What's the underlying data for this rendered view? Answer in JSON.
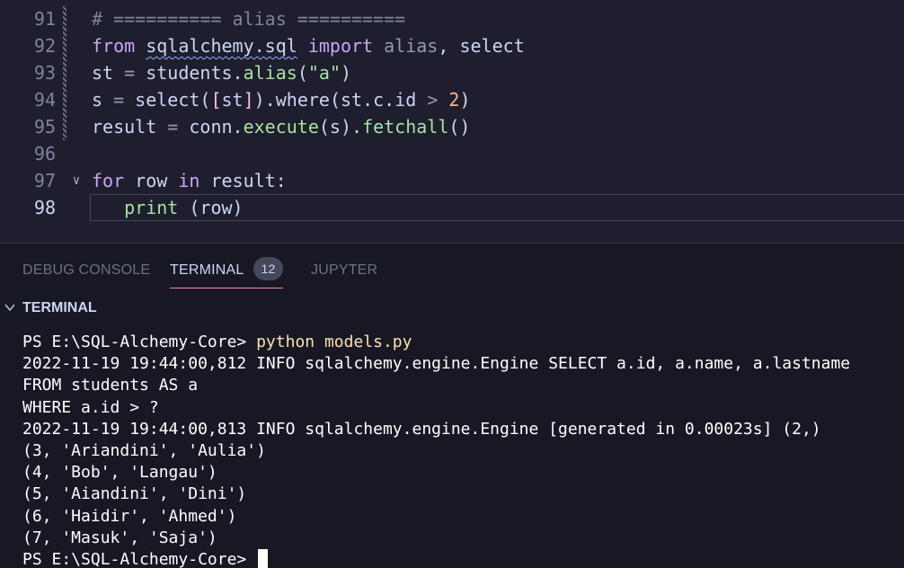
{
  "editor": {
    "lines": [
      {
        "num": "91",
        "tokens": [
          {
            "t": "# ========== alias ==========",
            "c": "c"
          }
        ]
      },
      {
        "num": "92",
        "tokens": [
          {
            "t": "from",
            "c": "k"
          },
          {
            "t": " ",
            "c": ""
          },
          {
            "t": "sqlalchemy.sql",
            "c": "sq"
          },
          {
            "t": " ",
            "c": ""
          },
          {
            "t": "import",
            "c": "k"
          },
          {
            "t": " ",
            "c": ""
          },
          {
            "t": "alias",
            "c": "p"
          },
          {
            "t": ", select",
            "c": ""
          }
        ]
      },
      {
        "num": "93",
        "tokens": [
          {
            "t": "st ",
            "c": ""
          },
          {
            "t": "=",
            "c": "p"
          },
          {
            "t": " students.",
            "c": ""
          },
          {
            "t": "alias",
            "c": "f"
          },
          {
            "t": "(",
            "c": ""
          },
          {
            "t": "\"a\"",
            "c": "s"
          },
          {
            "t": ")",
            "c": ""
          }
        ]
      },
      {
        "num": "94",
        "tokens": [
          {
            "t": "s ",
            "c": ""
          },
          {
            "t": "=",
            "c": "p"
          },
          {
            "t": " select(",
            "c": ""
          },
          {
            "t": "[",
            "c": "b"
          },
          {
            "t": "st",
            "c": ""
          },
          {
            "t": "]",
            "c": "b"
          },
          {
            "t": ").where(st.c.id ",
            "c": ""
          },
          {
            "t": ">",
            "c": "p"
          },
          {
            "t": " ",
            "c": ""
          },
          {
            "t": "2",
            "c": "n"
          },
          {
            "t": ")",
            "c": ""
          }
        ]
      },
      {
        "num": "95",
        "tokens": [
          {
            "t": "result ",
            "c": ""
          },
          {
            "t": "=",
            "c": "p"
          },
          {
            "t": " conn.",
            "c": ""
          },
          {
            "t": "execute",
            "c": "f"
          },
          {
            "t": "(s).",
            "c": ""
          },
          {
            "t": "fetchall",
            "c": "f"
          },
          {
            "t": "()",
            "c": ""
          }
        ]
      },
      {
        "num": "96",
        "tokens": []
      },
      {
        "num": "97",
        "fold": "∨",
        "tokens": [
          {
            "t": "for",
            "c": "k"
          },
          {
            "t": " row ",
            "c": ""
          },
          {
            "t": "in",
            "c": "k"
          },
          {
            "t": " result:",
            "c": ""
          }
        ]
      },
      {
        "num": "98",
        "current": true,
        "tokens": [
          {
            "t": "   ",
            "c": ""
          },
          {
            "t": "print",
            "c": "f"
          },
          {
            "t": " (row)",
            "c": ""
          }
        ]
      }
    ]
  },
  "panel": {
    "tabs": [
      {
        "label": "DEBUG CONSOLE",
        "active": false
      },
      {
        "label": "TERMINAL",
        "active": true,
        "badge": "12"
      },
      {
        "label": "JUPYTER",
        "active": false
      }
    ],
    "section_title": "TERMINAL",
    "terminal": {
      "prompt1": "PS E:\\SQL-Alchemy-Core> ",
      "command": "python models.py",
      "output": [
        "2022-11-19 19:44:00,812 INFO sqlalchemy.engine.Engine SELECT a.id, a.name, a.lastname",
        "FROM students AS a",
        "WHERE a.id > ?",
        "2022-11-19 19:44:00,813 INFO sqlalchemy.engine.Engine [generated in 0.00023s] (2,)",
        "(3, 'Ariandini', 'Aulia')",
        "(4, 'Bob', 'Langau')",
        "(5, 'Aiandini', 'Dini')",
        "(6, 'Haidir', 'Ahmed')",
        "(7, 'Masuk', 'Saja')"
      ],
      "prompt2": "PS E:\\SQL-Alchemy-Core> "
    }
  },
  "colors": {
    "editor_bg": "#1e1e2e",
    "panel_bg": "#181825",
    "keyword": "#cba6f7",
    "function": "#a6e3a1",
    "number": "#fab387",
    "comment": "#7f849c",
    "command": "#f9e2af",
    "active_tab_underline": "#f38ba8"
  }
}
